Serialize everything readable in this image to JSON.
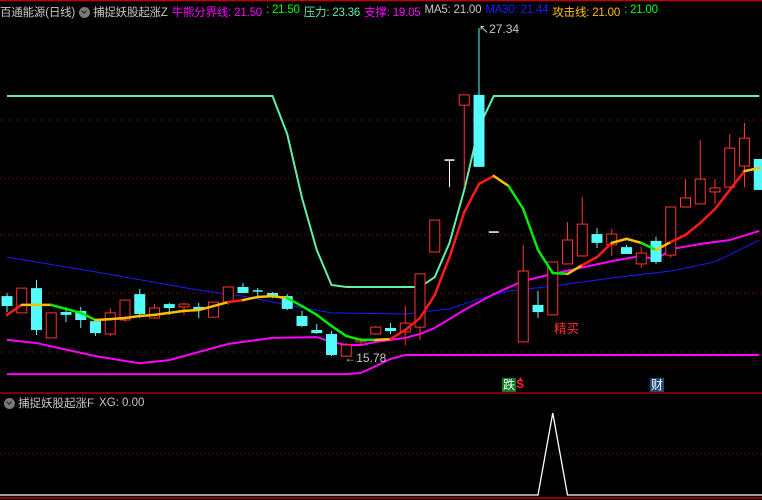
{
  "header": {
    "stock": "百通能源(日线)",
    "indicator": "捕捉妖股起涨Z",
    "items": [
      {
        "text": "牛熊分界线: 21.50",
        "color": "#ff00ff"
      },
      {
        "text": ": 21.50",
        "color": "#00ff00"
      },
      {
        "text": "压力: 23.36",
        "color": "#60f0a8"
      },
      {
        "text": "支撑: 19.05",
        "color": "#ff00ff"
      },
      {
        "text": "MA5: 21.00",
        "color": "#c8c8c8"
      },
      {
        "text": "MA30: 21.44",
        "color": "#1a1aff"
      },
      {
        "text": "攻击线: 21.00",
        "color": "#ffc000"
      },
      {
        "text": ": 21.00",
        "color": "#00ff00"
      }
    ]
  },
  "sub_header": {
    "indicator": "捕捉妖股起涨F",
    "value": "XG: 0.00"
  },
  "annotations": {
    "high_label": "27.34",
    "low_label": "15.78",
    "buy_signal": "精买",
    "tag_die": "跌",
    "tag_s": "S",
    "tag_cai": "财"
  },
  "colors": {
    "up": "#ff3232",
    "down": "#54fcfc",
    "doji": "#ffffff",
    "grid": "#8a1010",
    "attack_up": "#ff1a1a",
    "attack_flat": "#ffc000",
    "attack_down": "#00ee00"
  },
  "chart_data": {
    "type": "candlestick",
    "candles_ohlc": [
      [
        17.92,
        18.03,
        17.36,
        17.57
      ],
      [
        17.33,
        18.2,
        17.33,
        18.2
      ],
      [
        18.2,
        18.49,
        16.55,
        16.73
      ],
      [
        16.45,
        17.36,
        16.45,
        17.33
      ],
      [
        17.36,
        17.54,
        17.01,
        17.26
      ],
      [
        17.4,
        17.54,
        16.8,
        17.08
      ],
      [
        17.04,
        17.11,
        16.52,
        16.62
      ],
      [
        16.59,
        17.5,
        16.52,
        17.33
      ],
      [
        17.08,
        17.78,
        17.01,
        17.78
      ],
      [
        17.99,
        18.17,
        17.15,
        17.29
      ],
      [
        17.15,
        17.64,
        17.15,
        17.5
      ],
      [
        17.64,
        17.68,
        17.26,
        17.5
      ],
      [
        17.54,
        17.68,
        17.26,
        17.64
      ],
      [
        17.54,
        17.68,
        17.15,
        17.43
      ],
      [
        17.18,
        17.71,
        17.18,
        17.71
      ],
      [
        17.71,
        18.24,
        17.61,
        18.24
      ],
      [
        18.24,
        18.38,
        18.03,
        18.03
      ],
      [
        18.1,
        18.2,
        17.92,
        18.06
      ],
      [
        18.03,
        18.06,
        17.85,
        17.89
      ],
      [
        17.92,
        17.99,
        17.43,
        17.47
      ],
      [
        17.22,
        17.4,
        16.83,
        16.87
      ],
      [
        16.73,
        16.94,
        16.59,
        16.62
      ],
      [
        16.59,
        16.69,
        15.81,
        15.85
      ],
      [
        15.81,
        16.27,
        15.78,
        16.2
      ],
      [
        16.31,
        16.45,
        16.2,
        16.38
      ],
      [
        16.59,
        16.87,
        16.55,
        16.83
      ],
      [
        16.8,
        16.97,
        16.59,
        16.69
      ],
      [
        16.66,
        17.57,
        16.2,
        16.97
      ],
      [
        16.83,
        18.7,
        16.38,
        18.7
      ],
      [
        19.47,
        20.59,
        19.47,
        20.59
      ],
      [
        22.7,
        22.7,
        21.75,
        22.7
      ],
      [
        24.63,
        24.99,
        21.75,
        24.99
      ],
      [
        24.99,
        27.34,
        22.46,
        22.46
      ],
      [
        20.17,
        20.17,
        20.17,
        20.17
      ],
      null,
      [
        16.31,
        19.72,
        16.31,
        18.8
      ],
      [
        17.61,
        18.1,
        17.15,
        17.36
      ],
      [
        17.26,
        19.12,
        17.26,
        19.12
      ],
      [
        19.05,
        20.52,
        19.05,
        19.89
      ],
      [
        19.33,
        21.4,
        19.33,
        20.45
      ],
      [
        20.1,
        20.31,
        19.61,
        19.79
      ],
      [
        19.72,
        20.28,
        19.33,
        20.1
      ],
      [
        19.64,
        19.72,
        19.4,
        19.4
      ],
      [
        19.05,
        19.64,
        18.91,
        19.43
      ],
      [
        19.86,
        20.0,
        19.05,
        19.12
      ],
      [
        19.36,
        21.05,
        19.26,
        21.05
      ],
      [
        21.05,
        22.03,
        21.05,
        21.37
      ],
      [
        21.16,
        23.4,
        21.16,
        22.03
      ],
      [
        21.58,
        22.03,
        21.16,
        21.72
      ],
      [
        21.75,
        23.61,
        21.75,
        23.12
      ],
      [
        22.49,
        24.0,
        21.75,
        23.47
      ],
      [
        22.74,
        22.74,
        21.65,
        21.65
      ]
    ],
    "lines": [
      {
        "name": "压力",
        "color": "#60f0a8",
        "points": [
          [
            0,
            24.95
          ],
          [
            18,
            24.95
          ],
          [
            19,
            23.61
          ],
          [
            20,
            21.37
          ],
          [
            21,
            19.54
          ],
          [
            22,
            18.31
          ],
          [
            23,
            18.24
          ],
          [
            28,
            18.24
          ],
          [
            29,
            18.59
          ],
          [
            30,
            19.79
          ],
          [
            31,
            21.65
          ],
          [
            32,
            23.86
          ],
          [
            33,
            24.95
          ],
          [
            51,
            24.95
          ]
        ]
      },
      {
        "name": "MA30",
        "color": "#1a1aff",
        "points": [
          [
            0,
            19.29
          ],
          [
            6,
            18.77
          ],
          [
            13,
            18.13
          ],
          [
            16,
            17.92
          ],
          [
            19,
            17.61
          ],
          [
            22,
            17.33
          ],
          [
            27,
            17.29
          ],
          [
            30,
            17.47
          ],
          [
            32,
            17.82
          ],
          [
            34,
            18.1
          ],
          [
            37,
            18.27
          ],
          [
            41,
            18.56
          ],
          [
            45,
            18.8
          ],
          [
            48,
            19.12
          ],
          [
            51,
            19.89
          ]
        ]
      },
      {
        "color": "#ff00ff",
        "points": [
          [
            0,
            16.38
          ],
          [
            2,
            16.27
          ],
          [
            6,
            15.81
          ],
          [
            9,
            15.56
          ],
          [
            11,
            15.67
          ],
          [
            15,
            16.24
          ],
          [
            18,
            16.45
          ],
          [
            21,
            16.48
          ],
          [
            22,
            16.31
          ],
          [
            23,
            16.2
          ],
          [
            24,
            16.2
          ],
          [
            25,
            16.31
          ],
          [
            26,
            16.38
          ],
          [
            27,
            16.45
          ],
          [
            28,
            16.59
          ],
          [
            29,
            16.8
          ],
          [
            31,
            17.43
          ],
          [
            33,
            17.99
          ],
          [
            35,
            18.45
          ],
          [
            37,
            18.7
          ],
          [
            41,
            19.15
          ],
          [
            43,
            19.33
          ],
          [
            44,
            19.19
          ],
          [
            45,
            19.57
          ],
          [
            47,
            19.75
          ],
          [
            49,
            19.89
          ],
          [
            51,
            20.21
          ]
        ]
      },
      {
        "color": "#ff00ff",
        "points": [
          [
            0,
            15.18
          ],
          [
            23,
            15.18
          ],
          [
            24,
            15.22
          ],
          [
            25,
            15.46
          ],
          [
            26,
            15.71
          ],
          [
            27,
            15.85
          ],
          [
            51,
            15.85
          ]
        ]
      }
    ],
    "attack_line": {
      "name": "攻击线",
      "values": [
        17.26,
        17.61,
        17.61,
        17.61,
        17.47,
        17.33,
        17.08,
        17.11,
        17.15,
        17.22,
        17.26,
        17.33,
        17.4,
        17.43,
        17.57,
        17.71,
        17.78,
        17.89,
        17.92,
        17.85,
        17.57,
        17.26,
        16.87,
        16.52,
        16.38,
        16.38,
        16.41,
        16.73,
        17.15,
        17.96,
        19.29,
        20.87,
        21.86,
        22.14,
        21.79,
        20.98,
        19.54,
        18.73,
        18.7,
        19.01,
        19.29,
        19.79,
        19.93,
        19.79,
        19.54,
        19.82,
        20.07,
        20.49,
        20.98,
        21.65,
        22.31,
        22.42
      ],
      "segment_colors": "ryygggyyyyyyyyyryyyggggggyrrrrrrryggggyrryygyrrrrry"
    },
    "high_index": 32,
    "high": 27.34,
    "low_index": 23,
    "low": 15.78,
    "buy_signal_index": 37,
    "xg": {
      "signal_index": 37,
      "signal_value": 1,
      "baseline": 0
    }
  }
}
